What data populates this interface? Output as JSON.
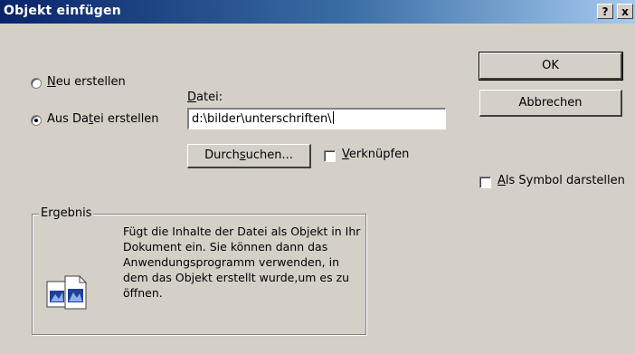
{
  "window": {
    "title": "Objekt einfügen",
    "help_button": "?",
    "close_button": "x"
  },
  "options": {
    "new": {
      "pre": "",
      "accel": "N",
      "post": "eu erstellen",
      "selected": false
    },
    "from_file": {
      "pre": "Aus Da",
      "accel": "t",
      "post": "ei erstellen",
      "selected": true
    }
  },
  "file": {
    "label_accel": "D",
    "label_rest": "atei:",
    "value": "d:\\bilder\\unterschriften\\"
  },
  "buttons": {
    "ok": "OK",
    "cancel": "Abbrechen",
    "browse_pre": "Durch",
    "browse_accel": "s",
    "browse_post": "uchen..."
  },
  "link_checkbox": {
    "accel": "V",
    "rest": "erknüpfen",
    "checked": false
  },
  "symbol_checkbox": {
    "accel": "A",
    "rest": "ls Symbol darstellen",
    "checked": false
  },
  "result": {
    "legend": "Ergebnis",
    "text": "Fügt die Inhalte der Datei als Objekt in Ihr Dokument ein. Sie können dann das Anwendungsprogramm verwenden, in dem das Objekt erstellt wurde,um es zu öffnen."
  },
  "icons": {
    "result_icon": "document-object-icon"
  }
}
